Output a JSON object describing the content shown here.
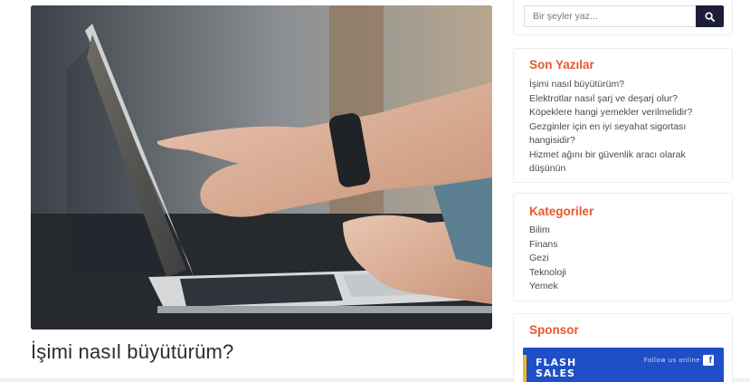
{
  "post": {
    "title": "İşimi nasıl büyütürüm?"
  },
  "search": {
    "placeholder": "Bir şeyler yaz..."
  },
  "recent_posts": {
    "heading": "Son Yazılar",
    "items": [
      "İşimi nasıl büyütürüm?",
      "Elektrotlar nasıl şarj ve deşarj olur?",
      "Köpeklere hangi yemekler verilmelidir?",
      "Gezginler için en iyi seyahat sigortası hangisidir?",
      "Hizmet ağını bir güvenlik aracı olarak düşünün"
    ]
  },
  "categories": {
    "heading": "Kategoriler",
    "items": [
      "Bilim",
      "Finans",
      "Gezi",
      "Teknoloji",
      "Yemek"
    ]
  },
  "sponsor": {
    "heading": "Sponsor",
    "banner_line1": "FLASH",
    "banner_line2": "SALES",
    "follow_text": "Follow us online",
    "fb_glyph": "f"
  },
  "colors": {
    "accent": "#e9572b",
    "search_button": "#1e1d38",
    "banner": "#1f4fc7"
  },
  "icons": {
    "search_button": "search-icon",
    "sponsor_social": "facebook-icon"
  }
}
